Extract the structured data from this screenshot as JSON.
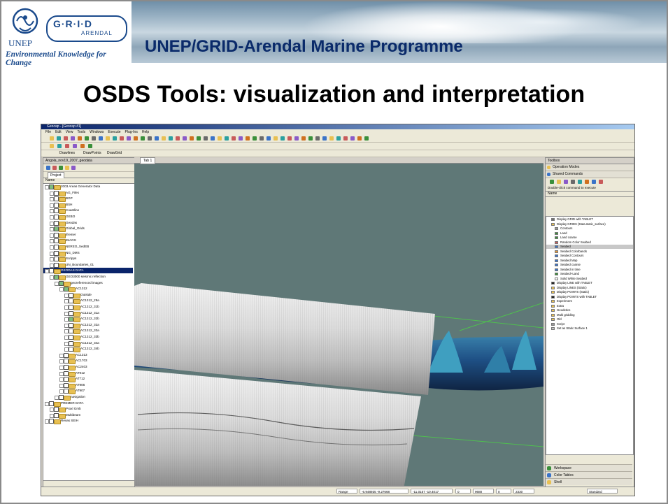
{
  "slide": {
    "header_title": "UNEP/GRID-Arendal Marine Programme",
    "title": "OSDS Tools: visualization and interpretation"
  },
  "logo": {
    "unep": "UNEP",
    "grid": "G·R·I·D",
    "arendal": "ARENDAL",
    "tagline": "Environmental Knowledge for Change"
  },
  "colors": {
    "header_title": "#0a2a6a",
    "viewport_bg": "#5f7877",
    "selection": "#0a246a"
  },
  "app": {
    "window_title": "Geocap - [Geocap #1]",
    "menu": [
      "File",
      "Edit",
      "View",
      "Tools",
      "Windows",
      "Execute",
      "Plug-Ins",
      "Help"
    ],
    "toolbar3": [
      "Drawlines",
      "DrawPoints",
      "DrawGrid"
    ],
    "left_panel": {
      "title": "Angola_nov19_2007_geodata",
      "tab": "Project",
      "column": "Name",
      "tree": [
        {
          "label": "2003 Areas Generator Data",
          "indent": 0,
          "checked": true
        },
        {
          "label": "AG_Files",
          "indent": 1
        },
        {
          "label": "BGP",
          "indent": 1
        },
        {
          "label": "BSH",
          "indent": 1
        },
        {
          "label": "Coastline",
          "indent": 1
        },
        {
          "label": "GEBO",
          "indent": 1
        },
        {
          "label": "Geodas",
          "indent": 1
        },
        {
          "label": "Global_Grids",
          "indent": 1,
          "checked": true
        },
        {
          "label": "Ifremer",
          "indent": 1
        },
        {
          "label": "IMAGS",
          "indent": 1
        },
        {
          "label": "NEREO_SedEB",
          "indent": 1
        },
        {
          "label": "NG_DMS",
          "indent": 1
        },
        {
          "label": "Scripps",
          "indent": 1
        },
        {
          "label": "UN_Boundaries_01",
          "indent": 1
        },
        {
          "label": "GEODAS DATA",
          "indent": 0,
          "selected": true
        },
        {
          "label": "GEO3000 seismic reflection",
          "indent": 1,
          "checked": true
        },
        {
          "label": "georeferenced images",
          "indent": 2,
          "checked": true
        },
        {
          "label": "AC1312",
          "indent": 3,
          "checked": true
        },
        {
          "label": "Outside",
          "indent": 4
        },
        {
          "label": "AC1312_29a",
          "indent": 4
        },
        {
          "label": "AC1312_31b",
          "indent": 4
        },
        {
          "label": "AC1312_31a",
          "indent": 4
        },
        {
          "label": "AC1312_32b",
          "indent": 4,
          "checked": true
        },
        {
          "label": "AC1312_32a",
          "indent": 4
        },
        {
          "label": "AC1312_33a",
          "indent": 4
        },
        {
          "label": "AC1312_33b",
          "indent": 4
        },
        {
          "label": "AC1312_34a",
          "indent": 4
        },
        {
          "label": "AC1312_34b",
          "indent": 4
        },
        {
          "label": "AC1313",
          "indent": 3
        },
        {
          "label": "AC1703",
          "indent": 3
        },
        {
          "label": "AC2403",
          "indent": 3
        },
        {
          "label": "AT912",
          "indent": 3
        },
        {
          "label": "AT712",
          "indent": 3
        },
        {
          "label": "AT906",
          "indent": 3
        },
        {
          "label": "AT907",
          "indent": 3
        },
        {
          "label": "navigation",
          "indent": 2
        },
        {
          "label": "PREMER DATA",
          "indent": 0
        },
        {
          "label": "Proxl Gmb",
          "indent": 1
        },
        {
          "label": "Multibeam",
          "indent": 1
        },
        {
          "label": "Revas SEIH",
          "indent": 0
        }
      ]
    },
    "center_tab": "Tab 1",
    "right_panel": {
      "title": "Toolbox",
      "sections": [
        "Operation Modes",
        "Shared Commands"
      ],
      "hint": "Double-click command to execute",
      "column": "Name",
      "commands": [
        {
          "label": "Display GRID with TABLET",
          "indent": 1,
          "color": "#6f6f6f"
        },
        {
          "label": "Display GRIDS (Data.static_surface)",
          "indent": 1,
          "color": "#e8c052"
        },
        {
          "label": "Contours",
          "indent": 2,
          "color": "#9a9a9a"
        },
        {
          "label": "Land",
          "indent": 2,
          "color": "#3a8f3a"
        },
        {
          "label": "Land coarse",
          "indent": 2,
          "color": "#3a8f3a"
        },
        {
          "label": "Random Color Seabed",
          "indent": 2,
          "color": "#c85a5a"
        },
        {
          "label": "Seabed",
          "indent": 2,
          "color": "#3a73c8",
          "selected": true
        },
        {
          "label": "Seabed Colorbands",
          "indent": 2,
          "color": "#e89a3a"
        },
        {
          "label": "Seabed Contours",
          "indent": 2,
          "color": "#3a73c8"
        },
        {
          "label": "Seabed Map",
          "indent": 2,
          "color": "#3a73c8"
        },
        {
          "label": "Seabed coarse",
          "indent": 2,
          "color": "#3a73c8"
        },
        {
          "label": "Seabed in time",
          "indent": 2,
          "color": "#3a73c8"
        },
        {
          "label": "Seabed+Land",
          "indent": 2,
          "color": "#3a8f3a"
        },
        {
          "label": "Solid White Seabed",
          "indent": 2,
          "color": "#ffffff"
        },
        {
          "label": "Display LINE with TABLET",
          "indent": 1,
          "color": "#222222"
        },
        {
          "label": "Display LINES (Static)",
          "indent": 1,
          "color": "#e8c052"
        },
        {
          "label": "Display POINTS (Static)",
          "indent": 1,
          "color": "#e8c052"
        },
        {
          "label": "Display POINTS with TABLET",
          "indent": 1,
          "color": "#222222"
        },
        {
          "label": "Experiment",
          "indent": 1,
          "color": "#e8c052"
        },
        {
          "label": "Extra",
          "indent": 1,
          "color": "#e8c052"
        },
        {
          "label": "Geodetics",
          "indent": 1,
          "color": "#e8c052"
        },
        {
          "label": "Multi gridding",
          "indent": 1,
          "color": "#e8c052"
        },
        {
          "label": "Old",
          "indent": 1,
          "color": "#e8c052"
        },
        {
          "label": "Script",
          "indent": 1,
          "color": "#9a9a9a"
        },
        {
          "label": "Set as Static Surface 1",
          "indent": 1,
          "color": "#c0c0c0"
        }
      ],
      "bottom_sections": [
        "Workspace",
        "Color Tables",
        "Shell"
      ]
    },
    "status": {
      "mode": "Range",
      "coord": "-6.948935 -9.27668",
      "coord2": "-11.0157 -10.4017",
      "v1": "0",
      "v2": "9680",
      "v3": "0",
      "v4": "2330",
      "render": "Standard"
    }
  }
}
